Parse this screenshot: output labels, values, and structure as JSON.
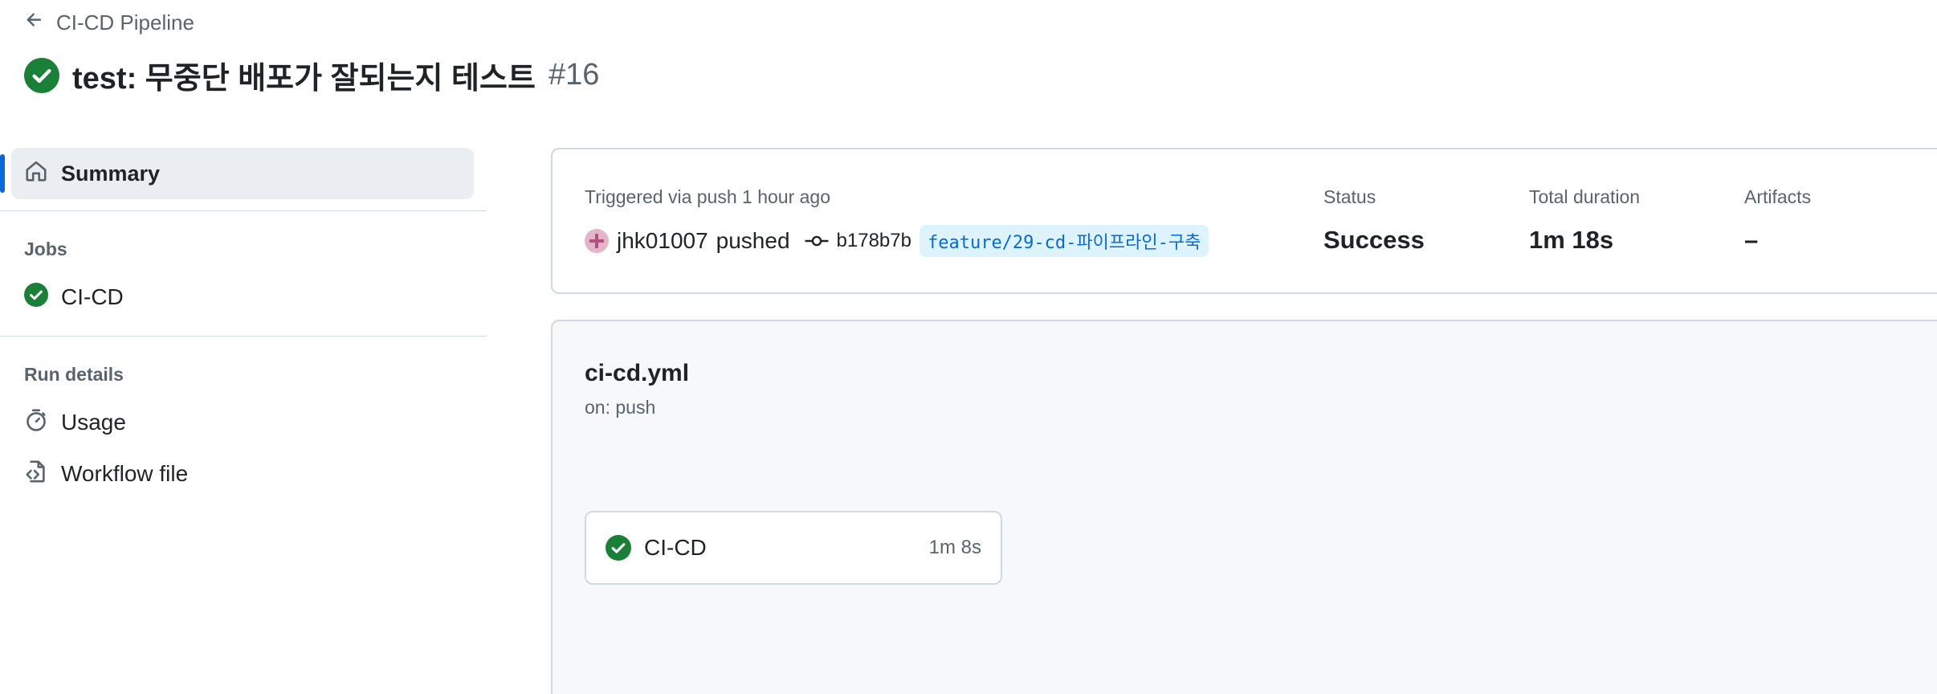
{
  "header": {
    "back_label": "CI-CD Pipeline",
    "title": "test: 무중단 배포가 잘되는지 테스트",
    "run_number": "#16"
  },
  "sidebar": {
    "summary_label": "Summary",
    "jobs_title": "Jobs",
    "jobs": [
      {
        "label": "CI-CD",
        "status": "success"
      }
    ],
    "run_details_title": "Run details",
    "run_details": [
      {
        "label": "Usage",
        "icon": "stopwatch-icon"
      },
      {
        "label": "Workflow file",
        "icon": "file-code-icon"
      }
    ]
  },
  "summary": {
    "trigger_text": "Triggered via push 1 hour ago",
    "user": "jhk01007",
    "action": "pushed",
    "commit_sha": "b178b7b",
    "branch": "feature/29-cd-파이프라인-구축",
    "status_label": "Status",
    "status_value": "Success",
    "duration_label": "Total duration",
    "duration_value": "1m 18s",
    "artifacts_label": "Artifacts",
    "artifacts_value": "–"
  },
  "workflow": {
    "file": "ci-cd.yml",
    "trigger": "on: push",
    "jobs": [
      {
        "name": "CI-CD",
        "duration": "1m 8s",
        "status": "success"
      }
    ]
  },
  "colors": {
    "success": "#1a7f37",
    "accent": "#0969da",
    "muted_text": "#59636e",
    "border": "#d1d9e0"
  }
}
